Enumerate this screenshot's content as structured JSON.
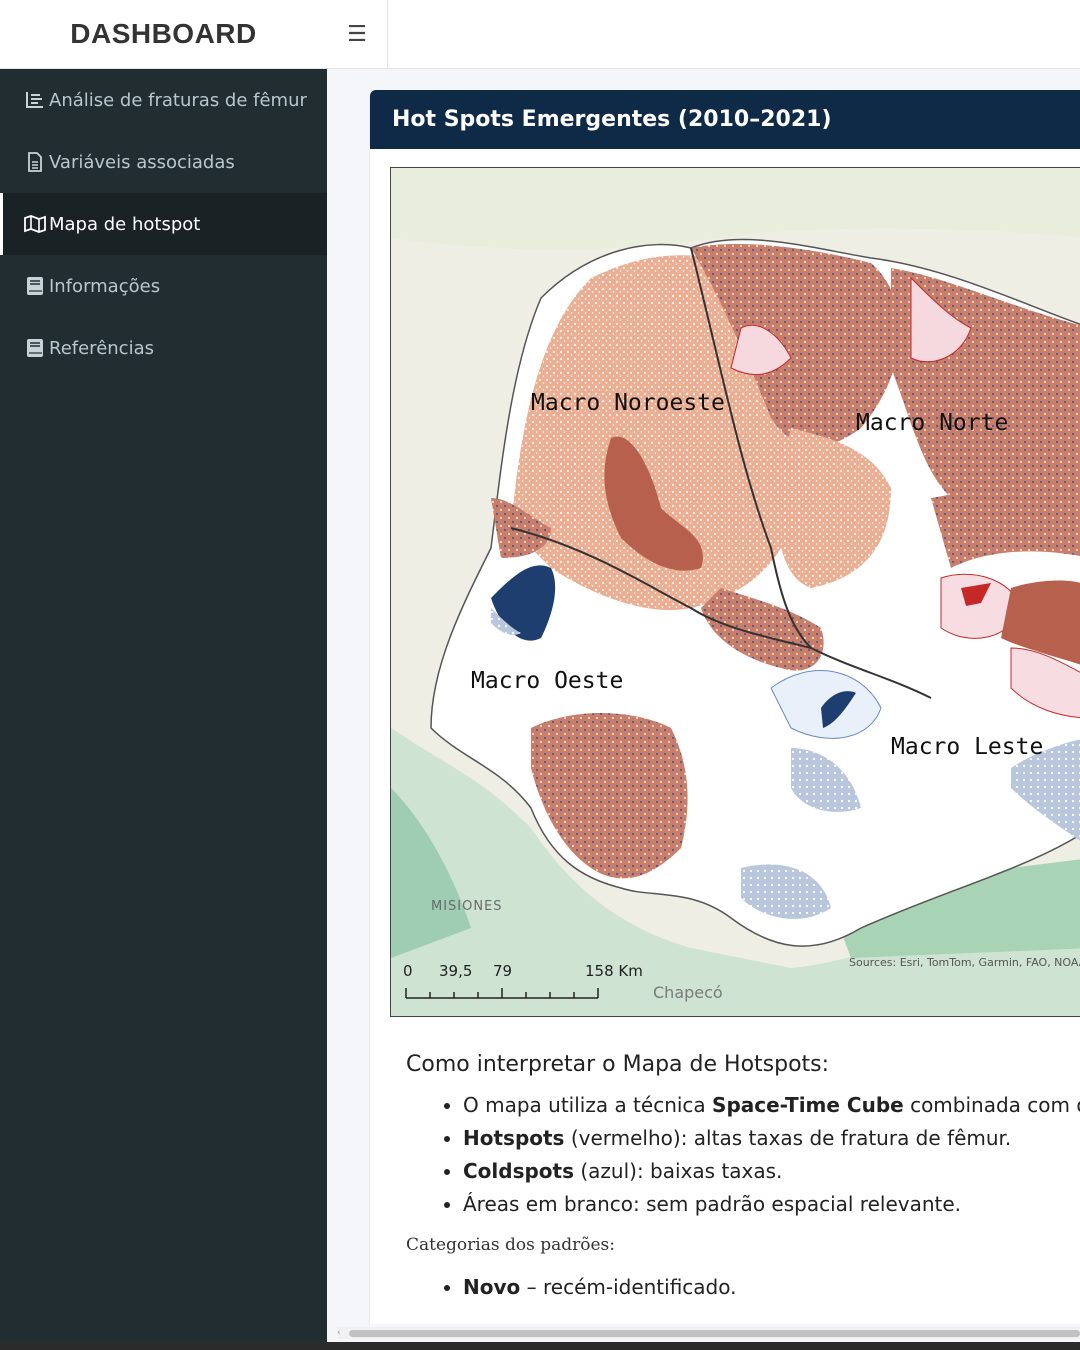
{
  "app": {
    "title": "DASHBOARD",
    "toggle_icon": "hamburger-icon"
  },
  "sidebar": {
    "items": [
      {
        "label": "Análise de fraturas de fêmur",
        "icon": "list-icon",
        "active": false
      },
      {
        "label": "Variáveis associadas",
        "icon": "file-icon",
        "active": false
      },
      {
        "label": "Mapa de hotspot",
        "icon": "map-icon",
        "active": true
      },
      {
        "label": "Informações",
        "icon": "book-icon",
        "active": false
      },
      {
        "label": "Referências",
        "icon": "book-icon",
        "active": false
      }
    ]
  },
  "box": {
    "title": "Hot Spots Emergentes (2010–2021)",
    "header_color": "#0e2a47"
  },
  "map": {
    "regions": [
      "Macro Noroeste",
      "Macro Norte",
      "Macro Oeste",
      "Macro Leste"
    ],
    "places": [
      "MISIONES",
      "Chapecó"
    ],
    "scale": {
      "ticks": [
        "0",
        "39,5",
        "79",
        "158 Km"
      ]
    },
    "sources": "Sources: Esri, TomTom, Garmin, FAO, NOAA",
    "colors": {
      "hotspot": "#b5584a",
      "hotspot_light": "#e9b39c",
      "coldspot": "#1d3e6e",
      "coldspot_light": "#aebfda",
      "background": "#ffffff"
    }
  },
  "interpret": {
    "heading": "Como interpretar o Mapa de Hotspots:",
    "bullets": [
      {
        "bold": "",
        "pre": "O mapa utiliza a técnica ",
        "strong": "Space-Time Cube",
        "rest": " combinada com o índ"
      },
      {
        "strong": "Hotspots",
        "rest": " (vermelho): altas taxas de fratura de fêmur."
      },
      {
        "strong": "Coldspots",
        "rest": " (azul): baixas taxas."
      },
      {
        "strong": "",
        "rest": "Áreas em branco: sem padrão espacial relevante."
      }
    ],
    "categories_label": "Categorias dos padrões:",
    "categories": [
      {
        "strong": "Novo",
        "rest": " – recém-identificado."
      }
    ]
  }
}
